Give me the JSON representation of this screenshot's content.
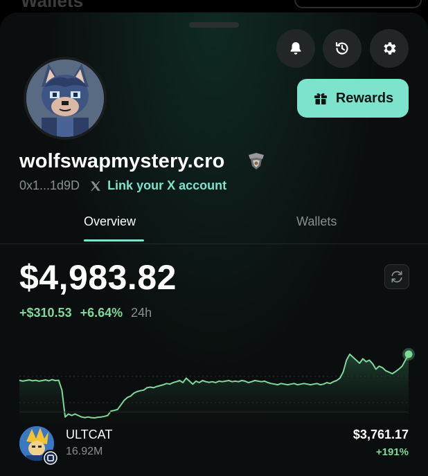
{
  "header": {
    "obscured_title": "Wallets"
  },
  "profile": {
    "username": "wolfswapmystery.cro",
    "address": "0x1...1d9D",
    "link_x_label": "Link your X account",
    "rewards_label": "Rewards"
  },
  "icons": {
    "notifications": "bell-icon",
    "history": "history-icon",
    "settings": "gear-icon",
    "rewards": "gift-icon",
    "x": "x-logo-icon",
    "refresh": "refresh-icon"
  },
  "tabs": [
    {
      "label": "Overview",
      "active": true
    },
    {
      "label": "Wallets",
      "active": false
    }
  ],
  "portfolio": {
    "balance": "$4,983.82",
    "change_abs": "+$310.53",
    "change_pct": "+6.64%",
    "period": "24h"
  },
  "chart_data": {
    "type": "area",
    "series": [
      {
        "values": [
          4673,
          4670,
          4672,
          4674,
          4671,
          4673,
          4670,
          4672,
          4674,
          4671,
          4675,
          4672,
          4673,
          4640,
          4550,
          4560,
          4555,
          4560,
          4555,
          4550,
          4548,
          4550,
          4548,
          4547,
          4549,
          4550,
          4552,
          4555,
          4570,
          4572,
          4575,
          4590,
          4605,
          4615,
          4620,
          4630,
          4635,
          4638,
          4640,
          4648,
          4650,
          4648,
          4652,
          4655,
          4658,
          4662,
          4660,
          4665,
          4668,
          4672,
          4665,
          4680,
          4670,
          4660,
          4670,
          4665,
          4672,
          4668,
          4666,
          4668,
          4665,
          4670,
          4668,
          4670,
          4672,
          4668,
          4670,
          4668,
          4672,
          4670,
          4665,
          4668,
          4672,
          4670,
          4668,
          4670,
          4665,
          4662,
          4660,
          4658,
          4662,
          4660,
          4658,
          4660,
          4662,
          4658,
          4660,
          4662,
          4660,
          4658,
          4660,
          4662,
          4658,
          4660,
          4665,
          4662,
          4668,
          4672,
          4680,
          4700,
          4740,
          4760,
          4750,
          4740,
          4730,
          4745,
          4735,
          4740,
          4728,
          4710,
          4720,
          4715,
          4705,
          4700,
          4695,
          4702,
          4710,
          4720,
          4740,
          4760
        ]
      }
    ],
    "accent": "#7ed99b"
  },
  "assets": [
    {
      "name": "ULTCAT",
      "amount": "16.92M",
      "value": "$3,761.17",
      "change": "+191%"
    }
  ],
  "colors": {
    "accent": "#7de3cd",
    "positive": "#7ed99b"
  }
}
